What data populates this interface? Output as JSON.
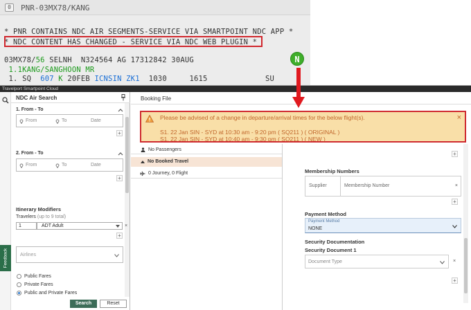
{
  "terminal": {
    "tab_badge": "0",
    "tab_title": "PNR-03MX78/KANG",
    "line1": "* PNR CONTAINS NDC AIR SEGMENTS-SERVICE VIA SMARTPOINT NDC APP *",
    "line2": "* NDC CONTENT HAS CHANGED - SERVICE VIA NDC WEB PLUGIN *",
    "line3a": "03MX78/",
    "line3b": "56",
    "line3c": " SELNH  N324564 AG 17312842 30AUG",
    "line4": " 1.1KANG/SANGHOON MR",
    "seg_num": " 1. SQ  ",
    "seg_flight": "607",
    "seg_class": " K ",
    "seg_date": "20FEB ",
    "seg_route": "ICNSIN",
    "seg_status": " ZK1",
    "seg_times": "  1030     1615",
    "seg_su": "SU",
    "ndc_badge": "N",
    "highlight_color": "#d0262c"
  },
  "app": {
    "title": "Travelport Smartpoint Cloud",
    "feedback": "Feedback",
    "search_panel": {
      "title": "NDC Air Search",
      "segments": [
        {
          "label": "1. From - To",
          "from": "From",
          "to": "To",
          "date": "Date"
        },
        {
          "label": "2. From - To",
          "from": "From",
          "to": "To",
          "date": "Date"
        }
      ],
      "itinerary_label": "Itinerary Modifiers",
      "travelers_label": "Travelers",
      "travelers_hint": "(up to 9 total)",
      "traveler_qty": "1",
      "traveler_type": "ADT Adult",
      "airlines_placeholder": "Airlines",
      "fare_options": [
        "Public Fares",
        "Private Fares",
        "Public and Private Fares"
      ],
      "fare_selected": 2,
      "search_btn": "Search",
      "reset_btn": "Reset",
      "clear": "×"
    },
    "booking": {
      "title": "Booking File",
      "banner": {
        "message": "Please be advised of a change in departure/arrival times for the below flight(s).",
        "seg1": "S1. 22 Jan SIN - SYD at 10:30 am - 9:20 pm ( SQ211 ) ( ORIGINAL )",
        "seg2": "S1. 22 Jan SIN - SYD at 10:40 am - 9:30 pm ( SQ211 ) ( NEW )",
        "close": "×",
        "bg_color": "#f9dfa8",
        "border_color": "#cf2a30",
        "text_color": "#c0652a"
      },
      "passengers": "No Passengers",
      "booked_travel": "No Booked Travel",
      "journey": "0 Journey, 0 Flight",
      "membership_title": "Membership Numbers",
      "membership_cols": [
        "Supplier",
        "Membership Number"
      ],
      "payment_title": "Payment Method",
      "payment_label": "Payment Method",
      "payment_value": "NONE",
      "security_title": "Security Documentation",
      "security_doc": "Security Document 1",
      "doc_type": "Document Type",
      "plus": "+",
      "clear": "×"
    }
  },
  "icons": [
    "search-icon",
    "pin-icon",
    "location-pin-icon",
    "chevron-up-icon",
    "chevron-down-icon",
    "warning-icon",
    "person-icon",
    "airplane-icon",
    "arrow-down-icon"
  ]
}
